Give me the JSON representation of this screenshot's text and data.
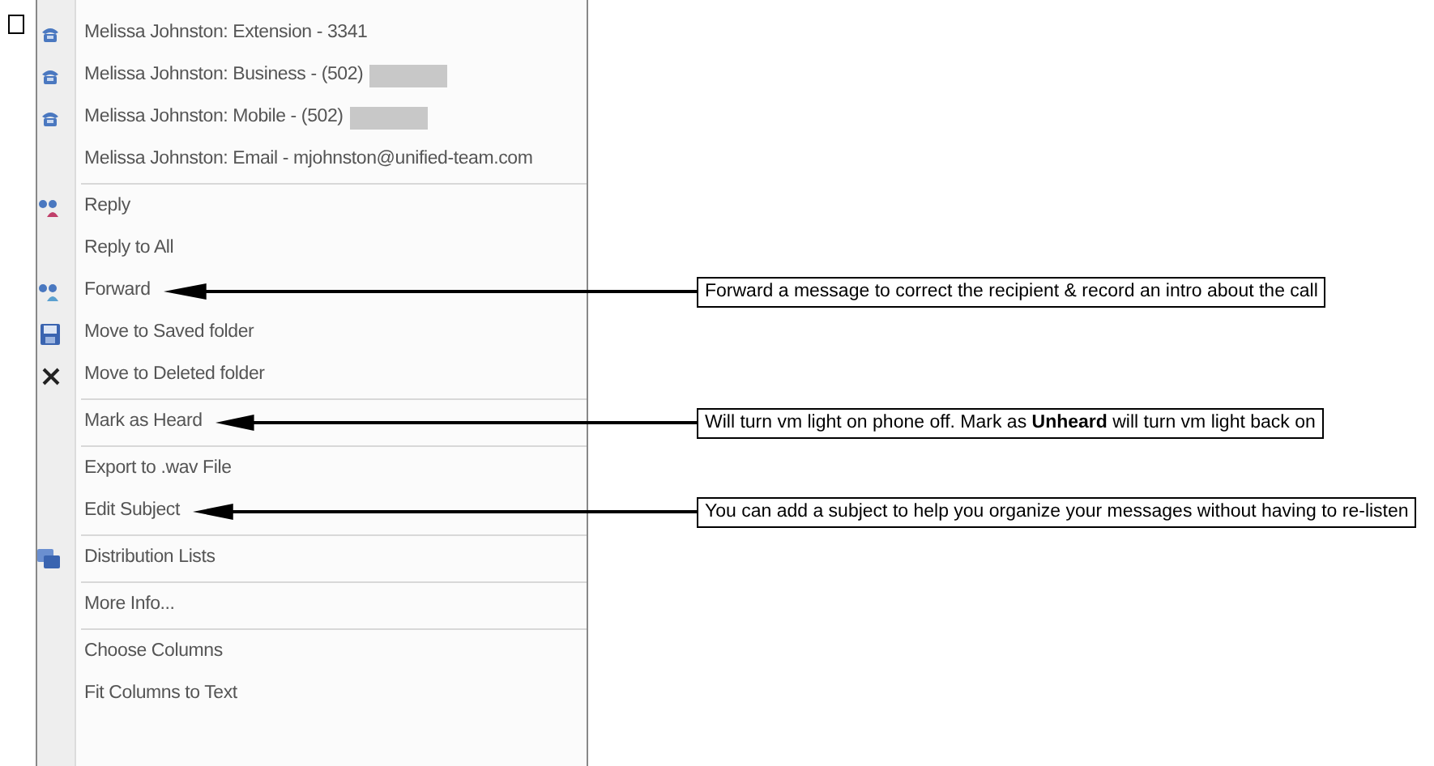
{
  "menu": {
    "items": [
      {
        "label": "Melissa Johnston: Extension - 3341",
        "kind": "phone",
        "separator_before": false
      },
      {
        "label": "Melissa Johnston: Business - (502)",
        "kind": "phone",
        "redacted": true,
        "separator_before": false
      },
      {
        "label": "Melissa Johnston: Mobile - (502)",
        "kind": "phone",
        "redacted": true,
        "separator_before": false
      },
      {
        "label": "Melissa Johnston: Email - mjohnston@unified-team.com",
        "separator_before": false
      },
      {
        "label": "Reply",
        "kind": "reply",
        "separator_before": true
      },
      {
        "label": "Reply to All",
        "separator_before": false
      },
      {
        "label": "Forward",
        "kind": "forward",
        "separator_before": false,
        "callout": "Forward a message to correct the recipient & record an intro about the call"
      },
      {
        "label": "Move to Saved folder",
        "kind": "save",
        "separator_before": false
      },
      {
        "label": "Move to Deleted folder",
        "kind": "delete",
        "separator_before": false
      },
      {
        "label": "Mark as Heard",
        "separator_before": true,
        "callout": "Will turn vm light on phone off.  Mark as **Unheard** will turn vm light back on"
      },
      {
        "label": "Export to .wav File",
        "separator_before": true
      },
      {
        "label": "Edit Subject",
        "separator_before": false,
        "callout": "You can add a subject to help you organize your messages without having to re-listen"
      },
      {
        "label": "Distribution Lists",
        "kind": "list",
        "separator_before": true
      },
      {
        "label": "More Info...",
        "separator_before": true
      },
      {
        "label": "Choose Columns",
        "separator_before": true
      },
      {
        "label": "Fit Columns to Text",
        "separator_before": false
      }
    ]
  }
}
